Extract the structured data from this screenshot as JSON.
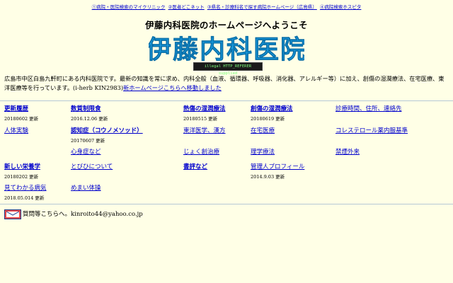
{
  "topnav": {
    "links": [
      "①病院・医院検索のマイクリニック",
      "②医者どこネット",
      "③県名・診療科名で探す病院ホームページ（広島県）",
      "④病院検索ホスピタ"
    ]
  },
  "header": {
    "welcome": "伊藤内科医院のホームページへようこそ",
    "logo_text": "伊藤内科医院",
    "badge": "illegal HTTP_REFERER supplied"
  },
  "intro": {
    "text": "広島市中区白島九軒町にある内科医院です。最新の知識を常に求め、内科全般（血液、循環器、呼吸器、消化器、アレルギー等）に加え、創傷の湿潤療法、在宅医療、東洋医療等を行っています。(i-herb KIN2983)",
    "link": "新ホームページこちらへ移動しました"
  },
  "menu": {
    "row1": [
      {
        "label": "更新履歴",
        "update": "20180602 更新"
      },
      {
        "label": "数質制限食",
        "update": "2016.12.06 更新"
      },
      {
        "label": "熱傷の湿潤療法",
        "update": "20180515 更新"
      },
      {
        "label": "創傷の湿潤療法",
        "update": "20180619 更新"
      },
      {
        "label": "診療時間、住所、連絡先",
        "update": ""
      }
    ],
    "row2": [
      {
        "label": "人体実験",
        "update": ""
      },
      {
        "label": "認知症（コウノメソッド）",
        "update": "20170607 更新"
      },
      {
        "label": "東洋医学、漢方",
        "update": ""
      },
      {
        "label": "在宅医療",
        "update": ""
      },
      {
        "label": "コレステロール薬内服基準",
        "update": ""
      }
    ],
    "row3": [
      {
        "label": "心身症など",
        "update": ""
      },
      {
        "label": "じょく創治療",
        "update": ""
      },
      {
        "label": "理学療法",
        "update": ""
      },
      {
        "label": "禁煙外来",
        "update": ""
      }
    ],
    "row4": [
      {
        "label": "新しい栄養学",
        "update": "20180202 更新"
      },
      {
        "label": "とびひについて",
        "update": ""
      },
      {
        "label": "書評など",
        "update": ""
      },
      {
        "label": "管理人プロフィール",
        "update": "2014.9.03 更新"
      }
    ],
    "row5": [
      {
        "label": "見てわかる病気",
        "update": "2018.05.014 更新"
      },
      {
        "label": "めまい体操",
        "update": ""
      }
    ]
  },
  "contact": {
    "icon": "mail-icon",
    "text": "質問等こちらへ。kinroito44@yahoo.co.jp"
  },
  "colors": {
    "background": "#ffffe6",
    "link": "#0000cc",
    "logo": "#1aa3e8"
  }
}
